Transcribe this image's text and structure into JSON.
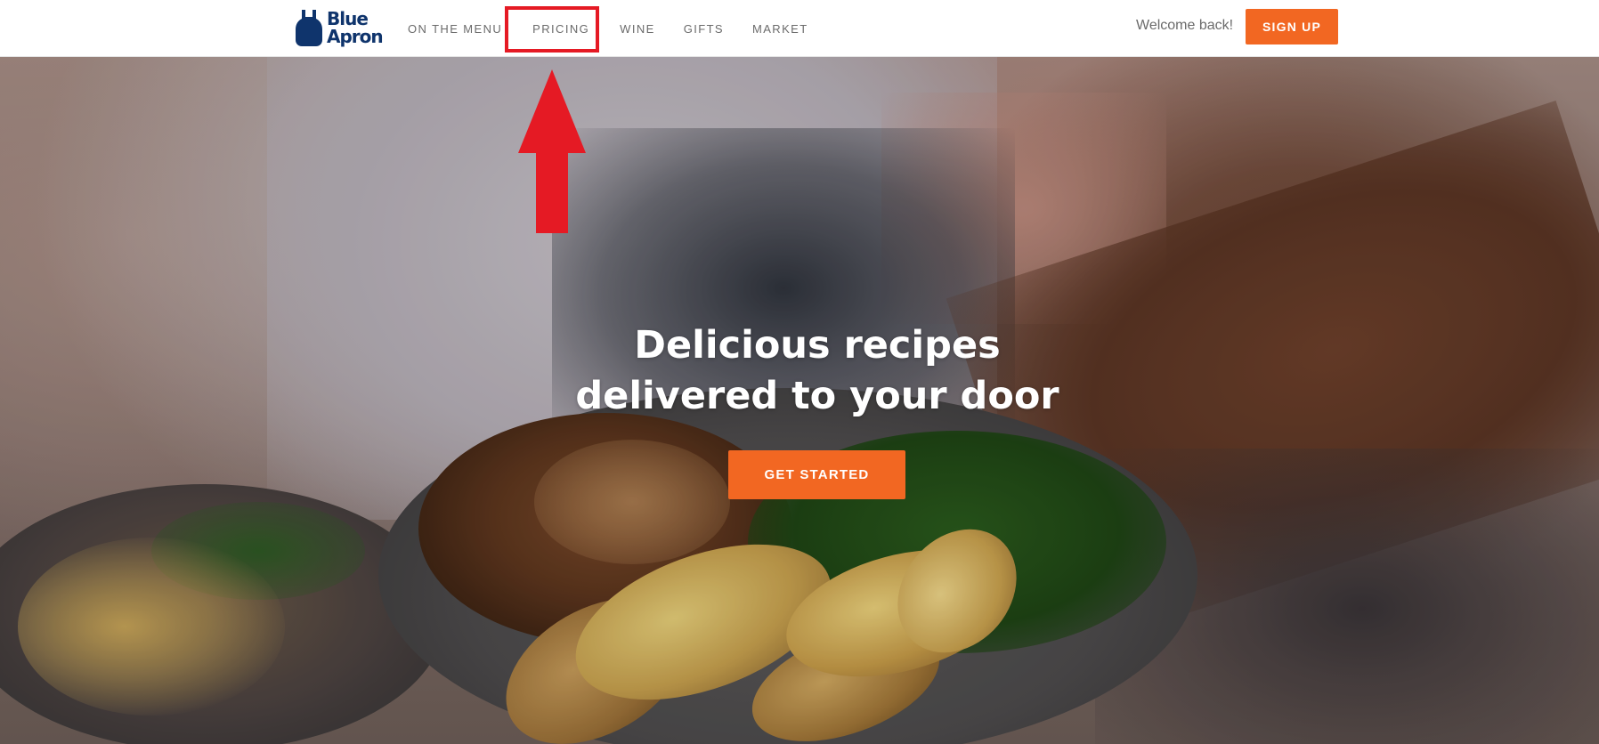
{
  "brand": {
    "logo_line1": "Blue",
    "logo_line2": "Apron",
    "color": "#0f346c"
  },
  "nav": {
    "items": [
      {
        "label": "ON THE MENU"
      },
      {
        "label": "PRICING",
        "highlighted": true
      },
      {
        "label": "WINE"
      },
      {
        "label": "GIFTS"
      },
      {
        "label": "MARKET"
      }
    ]
  },
  "header": {
    "welcome_text": "Welcome back!",
    "signup_label": "SIGN UP"
  },
  "hero": {
    "title_line1": "Delicious recipes",
    "title_line2": "delivered to your door",
    "cta_label": "GET STARTED"
  },
  "annotation": {
    "color": "#e51a24",
    "type": "arrow-up-pointing-to-highlighted-nav-item"
  },
  "colors": {
    "accent": "#f26722",
    "nav_text": "#6b6b6b"
  }
}
